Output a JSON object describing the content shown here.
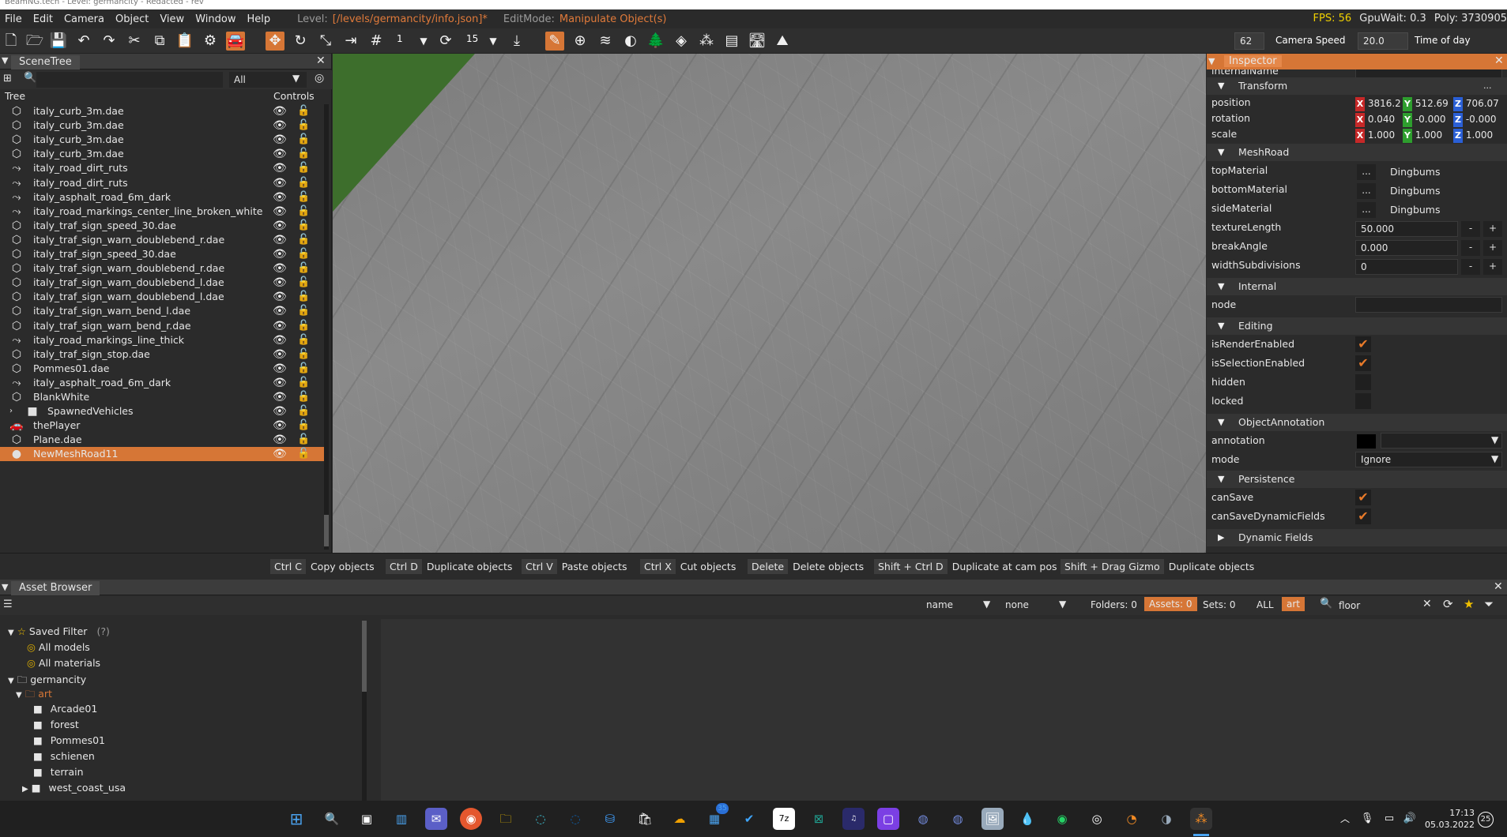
{
  "window_title": "BeamNG.tech - Level: germancity - Redacted - rev",
  "menu": {
    "items": [
      "File",
      "Edit",
      "Camera",
      "Object",
      "View",
      "Window",
      "Help"
    ],
    "level_label": "Level:",
    "level_path": "[/levels/germancity/info.json]*",
    "editmode_label": "EditMode:",
    "editmode_value": "Manipulate Object(s)",
    "fps": "FPS: 56",
    "gpuwait": "GpuWait: 0.3",
    "poly": "Poly: 3730905"
  },
  "toolbar": {
    "snap_value": "1",
    "rotate_value": "15",
    "camera_speed_value": "62",
    "camera_speed_label": "Camera Speed",
    "time_of_day_value": "20.0",
    "time_of_day_label": "Time of day"
  },
  "scenetree": {
    "tab": "SceneTree",
    "filter_value": "All",
    "col_tree": "Tree",
    "col_controls": "Controls",
    "rows": [
      {
        "label": "italy_curb_3m.dae",
        "icon": "cube-icon"
      },
      {
        "label": "italy_curb_3m.dae",
        "icon": "cube-icon"
      },
      {
        "label": "italy_curb_3m.dae",
        "icon": "cube-icon"
      },
      {
        "label": "italy_curb_3m.dae",
        "icon": "cube-icon"
      },
      {
        "label": "italy_road_dirt_ruts",
        "icon": "road-icon"
      },
      {
        "label": "italy_road_dirt_ruts",
        "icon": "road-icon"
      },
      {
        "label": "italy_asphalt_road_6m_dark",
        "icon": "road-icon"
      },
      {
        "label": "italy_road_markings_center_line_broken_white",
        "icon": "road-icon"
      },
      {
        "label": "italy_traf_sign_speed_30.dae",
        "icon": "cube-icon"
      },
      {
        "label": "italy_traf_sign_warn_doublebend_r.dae",
        "icon": "cube-icon"
      },
      {
        "label": "italy_traf_sign_speed_30.dae",
        "icon": "cube-icon"
      },
      {
        "label": "italy_traf_sign_warn_doublebend_r.dae",
        "icon": "cube-icon"
      },
      {
        "label": "italy_traf_sign_warn_doublebend_l.dae",
        "icon": "cube-icon"
      },
      {
        "label": "italy_traf_sign_warn_doublebend_l.dae",
        "icon": "cube-icon"
      },
      {
        "label": "italy_traf_sign_warn_bend_l.dae",
        "icon": "cube-icon"
      },
      {
        "label": "italy_traf_sign_warn_bend_r.dae",
        "icon": "cube-icon"
      },
      {
        "label": "italy_road_markings_line_thick",
        "icon": "road-icon"
      },
      {
        "label": "italy_traf_sign_stop.dae",
        "icon": "cube-icon"
      },
      {
        "label": "Pommes01.dae",
        "icon": "cube-icon"
      },
      {
        "label": "italy_asphalt_road_6m_dark",
        "icon": "road-icon"
      },
      {
        "label": "BlankWhite",
        "icon": "cube-icon"
      },
      {
        "label": "SpawnedVehicles",
        "icon": "folder-icon"
      },
      {
        "label": "thePlayer",
        "icon": "car-icon"
      },
      {
        "label": "Plane.dae",
        "icon": "cube-icon"
      },
      {
        "label": "NewMeshRoad11",
        "icon": "circle-icon",
        "selected": true
      }
    ]
  },
  "inspector": {
    "tab": "Inspector",
    "internal_name_label": "internalName",
    "sections": {
      "transform": "Transform",
      "meshroad": "MeshRoad",
      "internal": "Internal",
      "editing": "Editing",
      "annotation": "ObjectAnnotation",
      "persistence": "Persistence",
      "dynamic": "Dynamic Fields"
    },
    "position": {
      "label": "position",
      "x": "3816.2",
      "y": "512.69",
      "z": "706.07"
    },
    "rotation": {
      "label": "rotation",
      "x": "0.040",
      "y": "-0.000",
      "z": "-0.000"
    },
    "scale": {
      "label": "scale",
      "x": "1.000",
      "y": "1.000",
      "z": "1.000"
    },
    "topMaterial": {
      "label": "topMaterial",
      "value": "Dingbums"
    },
    "bottomMaterial": {
      "label": "bottomMaterial",
      "value": "Dingbums"
    },
    "sideMaterial": {
      "label": "sideMaterial",
      "value": "Dingbums"
    },
    "textureLength": {
      "label": "textureLength",
      "value": "50.000"
    },
    "breakAngle": {
      "label": "breakAngle",
      "value": "0.000"
    },
    "widthSubdivisions": {
      "label": "widthSubdivisions",
      "value": "0"
    },
    "node_label": "node",
    "isRenderEnabled": "isRenderEnabled",
    "isSelectionEnabled": "isSelectionEnabled",
    "hidden": "hidden",
    "locked": "locked",
    "annotation_label": "annotation",
    "mode_label": "mode",
    "mode_value": "Ignore",
    "canSave": "canSave",
    "canSaveDynamicFields": "canSaveDynamicFields",
    "browse_btn": "...",
    "minus": "-",
    "plus": "+"
  },
  "shortcuts": [
    {
      "key": "Ctrl C",
      "action": "Copy objects"
    },
    {
      "key": "Ctrl D",
      "action": "Duplicate objects"
    },
    {
      "key": "Ctrl V",
      "action": "Paste objects"
    },
    {
      "key": "Ctrl X",
      "action": "Cut objects"
    },
    {
      "key": "Delete",
      "action": "Delete objects"
    },
    {
      "key": "Shift + Ctrl D",
      "action": "Duplicate at cam pos"
    },
    {
      "key": "Shift + Drag Gizmo",
      "action": "Duplicate objects"
    }
  ],
  "assetbrowser": {
    "tab": "Asset Browser",
    "sort_value": "name",
    "group_value": "none",
    "folders": "Folders: 0",
    "assets": "Assets: 0",
    "sets": "Sets: 0",
    "all": "ALL",
    "art": "art",
    "search_value": "floor",
    "saved_filter": "Saved Filter",
    "saved_filter_help": "(?)",
    "all_models": "All models",
    "all_materials": "All materials",
    "root_folder": "germancity",
    "art_folder": "art",
    "folders_list": [
      "Arcade01",
      "forest",
      "Pommes01",
      "schienen",
      "terrain",
      "west_coast_usa"
    ]
  },
  "taskbar": {
    "time": "17:13",
    "date": "05.03.2022",
    "badge_store": "35",
    "badge_notif": "25"
  },
  "colors": {
    "accent": "#d67636",
    "fps": "#f0d000",
    "x_axis": "#c62828",
    "y_axis": "#2e9e2e",
    "z_axis": "#2a5fd6"
  }
}
